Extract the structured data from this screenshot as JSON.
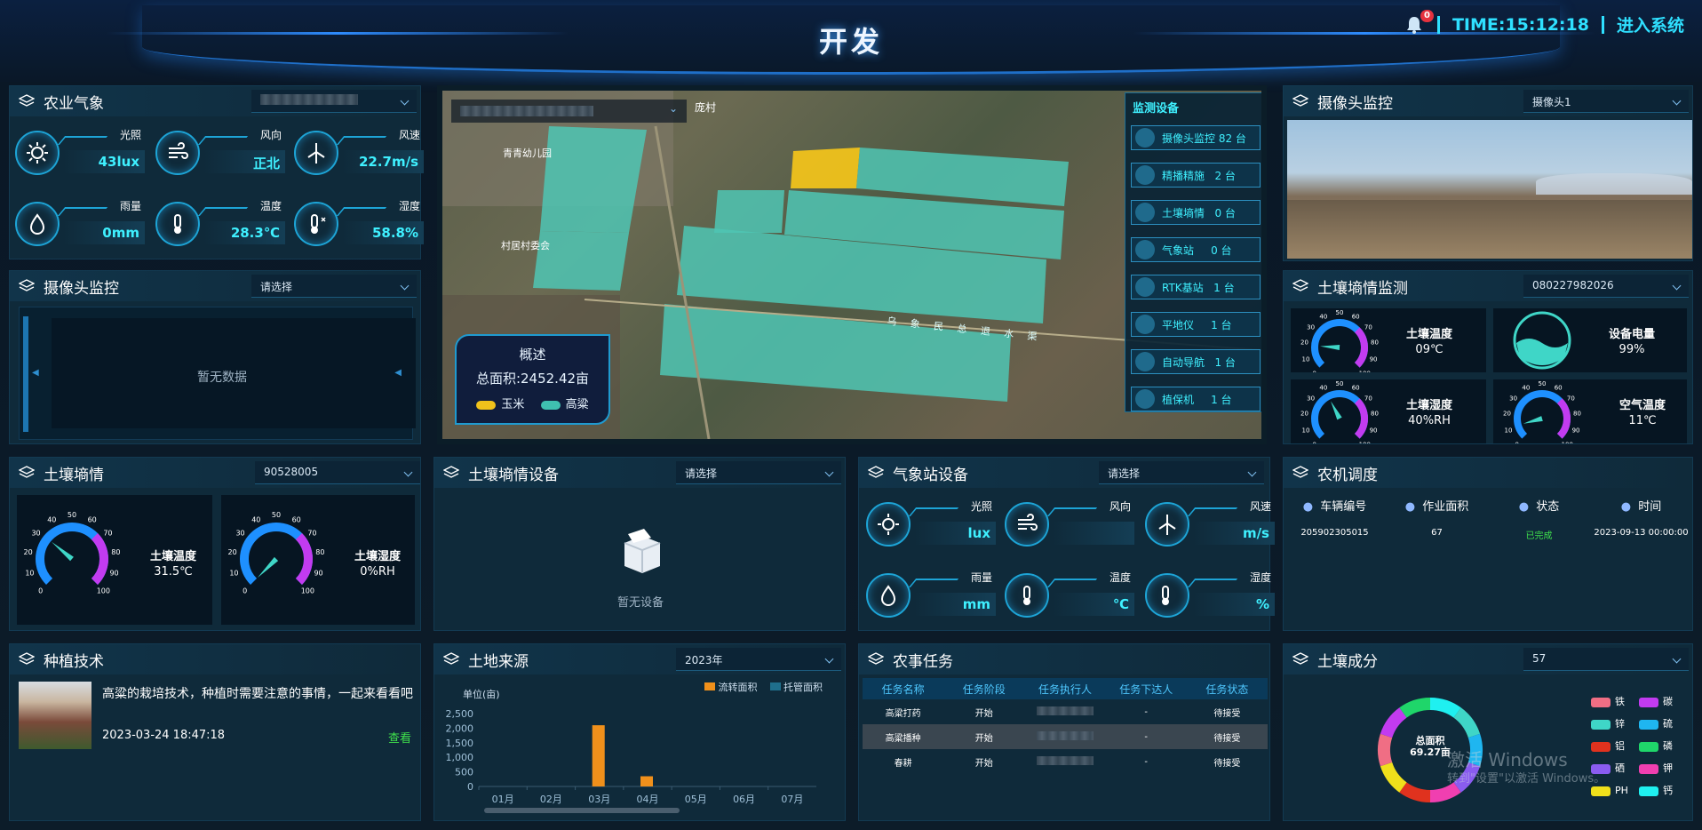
{
  "header": {
    "title": "开发",
    "notif_count": "0",
    "time": "TIME:15:12:18",
    "enter": "进入系统"
  },
  "weather": {
    "title": "农业气象",
    "items": [
      {
        "label": "光照",
        "value": "43lux",
        "icon": "sun-icon"
      },
      {
        "label": "风向",
        "value": "正北",
        "icon": "wind-direction-icon"
      },
      {
        "label": "风速",
        "value": "22.7m/s",
        "icon": "wind-turbine-icon"
      },
      {
        "label": "雨量",
        "value": "0mm",
        "icon": "rain-drop-icon"
      },
      {
        "label": "温度",
        "value": "28.3℃",
        "icon": "thermometer-icon"
      },
      {
        "label": "湿度",
        "value": "58.8%",
        "icon": "humidity-icon"
      }
    ]
  },
  "camera_left": {
    "title": "摄像头监控",
    "select": "请选择",
    "empty": "暂无数据"
  },
  "map": {
    "labels": {
      "village": "庞村",
      "kindergarten": "青青幼儿园",
      "committee": "村居村委会",
      "canal": "乌 象 民 总 退 水 渠"
    },
    "overview_title": "概述",
    "total": "总面积:2452.42亩",
    "legend": [
      {
        "name": "玉米",
        "color": "#f0c21b"
      },
      {
        "name": "高粱",
        "color": "#3fc0b0"
      }
    ],
    "monitor_title": "监测设备",
    "devices": [
      {
        "name": "摄像头监控",
        "count": "82 台",
        "icon": "camera-icon"
      },
      {
        "name": "精播精施",
        "count": "2 台",
        "icon": "tractor-icon"
      },
      {
        "name": "土壤墒情",
        "count": "0 台",
        "icon": "soil-probe-icon"
      },
      {
        "name": "气象站",
        "count": "0 台",
        "icon": "wind-turbine-icon"
      },
      {
        "name": "RTK基站",
        "count": "1 台",
        "icon": "phone-icon"
      },
      {
        "name": "平地仪",
        "count": "1 台",
        "icon": "leveler-icon"
      },
      {
        "name": "自动导航",
        "count": "1 台",
        "icon": "compass-icon"
      },
      {
        "name": "植保机",
        "count": "1 台",
        "icon": "plane-icon"
      }
    ]
  },
  "camera_right": {
    "title": "摄像头监控",
    "select": "摄像头1"
  },
  "soil_monitor": {
    "title": "土壤墒情监测",
    "select": "080227982026",
    "g1": {
      "label": "土壤温度",
      "value": "09℃"
    },
    "battery": {
      "label": "设备电量",
      "value": "99%"
    },
    "g2": {
      "label": "土壤湿度",
      "value": "40%RH"
    },
    "g3": {
      "label": "空气温度",
      "value": "11℃"
    }
  },
  "soil": {
    "title": "土壤墒情",
    "select": "90528005",
    "g1": {
      "label": "土壤温度",
      "value": "31.5℃"
    },
    "g2": {
      "label": "土壤湿度",
      "value": "0%RH"
    }
  },
  "soil_device": {
    "title": "土壤墒情设备",
    "select": "请选择",
    "empty": "暂无设备"
  },
  "station": {
    "title": "气象站设备",
    "select": "请选择",
    "items": [
      {
        "label": "光照",
        "value": "lux"
      },
      {
        "label": "风向",
        "value": ""
      },
      {
        "label": "风速",
        "value": "m/s"
      },
      {
        "label": "雨量",
        "value": "mm"
      },
      {
        "label": "温度",
        "value": "℃"
      },
      {
        "label": "湿度",
        "value": "%"
      }
    ]
  },
  "machine": {
    "title": "农机调度",
    "headers": [
      "车辆编号",
      "作业面积",
      "状态",
      "时间"
    ],
    "rows": [
      [
        "205902305015",
        "67",
        "已完成",
        "2023-09-13 00:00:00"
      ]
    ]
  },
  "tech": {
    "title": "种植技术",
    "text": "高粱的栽培技术，种植时需要注意的事情，一起来看看吧",
    "date": "2023-03-24 18:47:18",
    "link": "查看"
  },
  "land": {
    "title": "土地来源",
    "select": "2023年"
  },
  "tasks": {
    "title": "农事任务",
    "headers": [
      "任务名称",
      "任务阶段",
      "任务执行人",
      "任务下达人",
      "任务状态"
    ],
    "rows": [
      [
        "高粱打药",
        "开始",
        "",
        "-",
        "待接受"
      ],
      [
        "高粱播种",
        "开始",
        "",
        "-",
        "待接受"
      ],
      [
        "春耕",
        "开始",
        "",
        "-",
        "待接受"
      ]
    ]
  },
  "composition": {
    "title": "土壤成分",
    "select": "57",
    "center1": "总面积",
    "center2": "69.27亩",
    "legend": [
      {
        "name": "铁",
        "color": "#f06e84"
      },
      {
        "name": "碳",
        "color": "#c23bf0"
      },
      {
        "name": "锌",
        "color": "#3fd6c7"
      },
      {
        "name": "硫",
        "color": "#1fb6f0"
      },
      {
        "name": "铝",
        "color": "#e0321e"
      },
      {
        "name": "磷",
        "color": "#1fd66a"
      },
      {
        "name": "硒",
        "color": "#8a5cf0"
      },
      {
        "name": "钾",
        "color": "#f03fb0"
      },
      {
        "name": "PH",
        "color": "#f0e01b"
      },
      {
        "name": "钙",
        "color": "#1ff0f0"
      }
    ]
  },
  "watermark": {
    "line1": "激活 Windows",
    "line2": "转到\"设置\"以激活 Windows。"
  },
  "chart_data": {
    "type": "bar",
    "categories": [
      "01月",
      "02月",
      "03月",
      "04月",
      "05月",
      "06月",
      "07月"
    ],
    "series": [
      {
        "name": "流转面积",
        "color": "#f0901b",
        "values": [
          0,
          0,
          2100,
          350,
          0,
          0,
          0
        ]
      },
      {
        "name": "托管面积",
        "color": "#1f6f8c",
        "values": [
          0,
          0,
          0,
          0,
          0,
          0,
          0
        ]
      }
    ],
    "ylabel": "单位(亩)",
    "yticks": [
      "0",
      "500",
      "1,000",
      "1,500",
      "2,000",
      "2,500"
    ],
    "ylim": [
      0,
      2500
    ]
  }
}
